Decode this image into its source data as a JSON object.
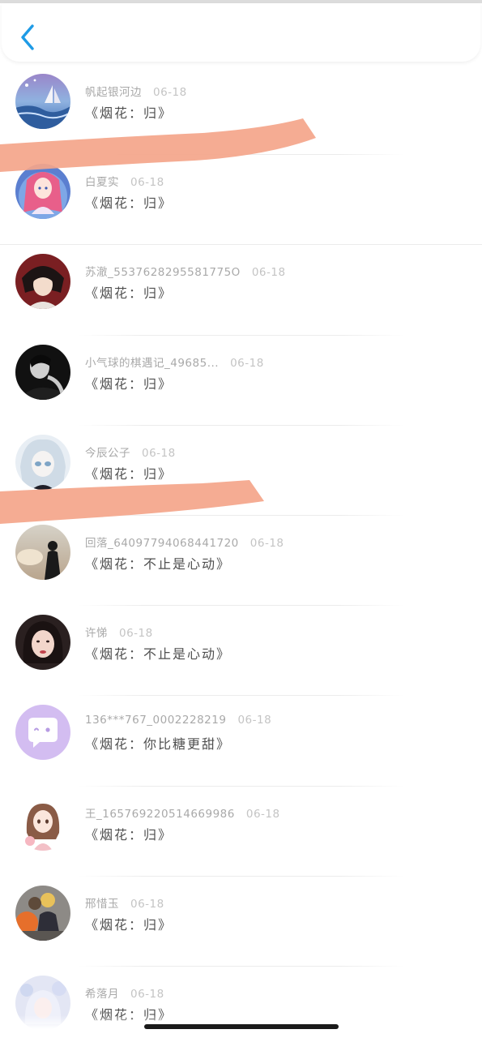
{
  "header": {
    "back_label": "<"
  },
  "colors": {
    "accent": "#1e9be6",
    "scribble": "#f4a58a",
    "name_text": "#a9a9a9",
    "message_text": "#4f4f4f"
  },
  "rows": [
    {
      "name": "帆起银河边",
      "date": "06-18",
      "message": "《烟花：归》",
      "avatar": "sea-sailboat"
    },
    {
      "name": "白夏实",
      "date": "06-18",
      "message": "《烟花：归》",
      "avatar": "anime-pink-hair"
    },
    {
      "name": "苏澈_5537628295581775O",
      "date": "06-18",
      "message": "《烟花：归》",
      "avatar": "anime-boy"
    },
    {
      "name": "小气球的棋遇记_49685...",
      "date": "06-18",
      "message": "《烟花：归》",
      "avatar": "dark-portrait"
    },
    {
      "name": "今辰公子",
      "date": "06-18",
      "message": "《烟花：归》",
      "avatar": "anime-white-hair"
    },
    {
      "name": "回落_640977940684417​20",
      "date": "06-18",
      "message": "《烟花：不止是心动》",
      "avatar": "sunset-silhouette"
    },
    {
      "name": "许悌",
      "date": "06-18",
      "message": "《烟花：不止是心动》",
      "avatar": "woman-portrait"
    },
    {
      "name": "136***767_0002228219",
      "date": "06-18",
      "message": "《烟花：你比糖更甜》",
      "avatar": "chat-bubble"
    },
    {
      "name": "王_165769220514669986",
      "date": "06-18",
      "message": "《烟花：归》",
      "avatar": "girl-drawing"
    },
    {
      "name": "邢惜玉",
      "date": "06-18",
      "message": "《烟花：归》",
      "avatar": "two-kids"
    },
    {
      "name": "希落月",
      "date": "06-18",
      "message": "《烟花：归》",
      "avatar": "anime-light"
    }
  ]
}
